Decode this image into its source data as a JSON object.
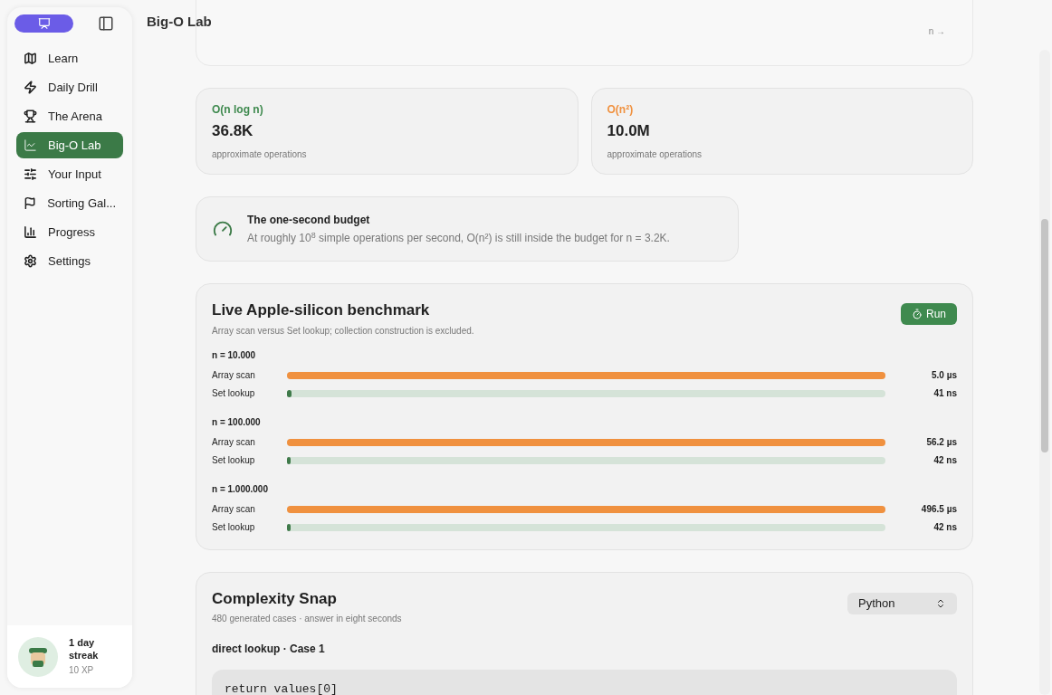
{
  "sidebar": {
    "items": [
      {
        "label": "Learn",
        "selected": false
      },
      {
        "label": "Daily Drill",
        "selected": false
      },
      {
        "label": "The Arena",
        "selected": false
      },
      {
        "label": "Big-O Lab",
        "selected": true
      },
      {
        "label": "Your Input",
        "selected": false
      },
      {
        "label": "Sorting Gal...",
        "selected": false
      },
      {
        "label": "Progress",
        "selected": false
      },
      {
        "label": "Settings",
        "selected": false
      }
    ],
    "profile": {
      "streak": "1 day streak",
      "xp": "10 XP"
    }
  },
  "header": {
    "title": "Big-O Lab"
  },
  "chart_card": {
    "axis_hint": "n →"
  },
  "stats": [
    {
      "label": "O(n log n)",
      "color": "#3f8a4f",
      "value": "36.8K",
      "caption": "approximate operations"
    },
    {
      "label": "O(n²)",
      "color": "#f0913f",
      "value": "10.0M",
      "caption": "approximate operations"
    }
  ],
  "budget": {
    "title": "The one-second budget",
    "text": "At roughly 10$^{8}$ simple operations per second, O(n²) is still inside the budget for n = 3.2K."
  },
  "benchmark": {
    "title": "Live Apple-silicon benchmark",
    "subtitle": "Array scan versus Set lookup; collection construction is excluded.",
    "button": "Run",
    "groups": [
      {
        "label": "n = 10.000",
        "rows": [
          {
            "kind": "array",
            "name": "Array scan",
            "level": 1,
            "reading": "5.0 µs"
          },
          {
            "kind": "set",
            "name": "Set lookup",
            "level": 0.008,
            "reading": "41 ns"
          }
        ]
      },
      {
        "label": "n = 100.000",
        "rows": [
          {
            "kind": "array",
            "name": "Array scan",
            "level": 1,
            "reading": "56.2 µs"
          },
          {
            "kind": "set",
            "name": "Set lookup",
            "level": 0.004,
            "reading": "42 ns"
          }
        ]
      },
      {
        "label": "n = 1.000.000",
        "rows": [
          {
            "kind": "array",
            "name": "Array scan",
            "level": 1,
            "reading": "496.5 µs"
          },
          {
            "kind": "set",
            "name": "Set lookup",
            "level": 0.004,
            "reading": "42 ns"
          }
        ]
      }
    ]
  },
  "snap": {
    "title": "Complexity Snap",
    "subtitle": "480 generated cases · answer in eight seconds",
    "language": "Python",
    "case_title": "direct lookup · Case 1",
    "code": "return values[0]"
  }
}
